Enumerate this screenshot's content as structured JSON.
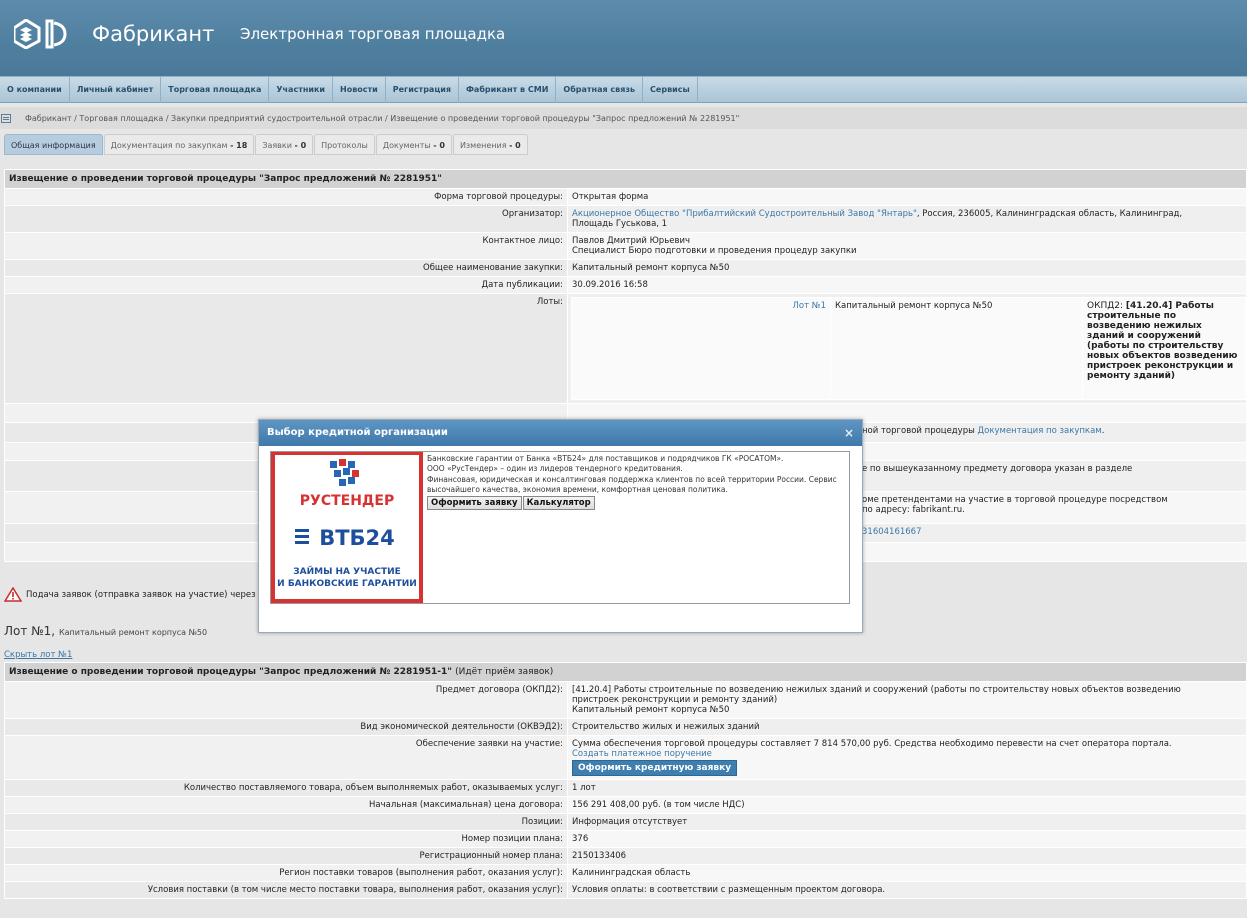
{
  "header": {
    "logo_text": "Фабрикант",
    "platform_title": "Электронная торговая площадка"
  },
  "nav": [
    "О компании",
    "Личный кабинет",
    "Торговая площадка",
    "Участники",
    "Новости",
    "Регистрация",
    "Фабрикант в СМИ",
    "Обратная связь",
    "Сервисы"
  ],
  "breadcrumb": "Фабрикант / Торговая площадка / Закупки предприятий судостроительной отрасли / Извещение о проведении торговой процедуры \"Запрос предложений № 2281951\"",
  "tabs": [
    {
      "label": "Общая информация",
      "count": ""
    },
    {
      "label": "Документация по закупкам",
      "count": "- 18"
    },
    {
      "label": "Заявки",
      "count": "- 0"
    },
    {
      "label": "Протоколы",
      "count": ""
    },
    {
      "label": "Документы",
      "count": "- 0"
    },
    {
      "label": "Изменения",
      "count": "- 0"
    }
  ],
  "notice": {
    "title": "Извещение о проведении торговой процедуры \"Запрос предложений № 2281951\"",
    "form_label": "Форма торговой процедуры:",
    "form_value": "Открытая форма",
    "org_label": "Организатор:",
    "org_link": "Акционерное Общество \"Прибалтийский Судостроительный Завод \"Янтарь\"",
    "org_rest": ", Россия, 236005, Калининградская область, Калининград,",
    "org_line2": "Площадь Гуськова, 1",
    "contact_label": "Контактное лицо:",
    "contact_name": "Павлов Дмитрий Юрьевич",
    "contact_role": "Специалист Бюро подготовки и проведения процедур закупки",
    "name_label": "Общее наименование закупки:",
    "name_value": "Капитальный ремонт корпуса №50",
    "date_label": "Дата публикации:",
    "date_value": "30.09.2016 16:58",
    "lots_label": "Лоты:",
    "lot_link": "Лот №1",
    "lot_name": "Капитальный ремонт корпуса №50",
    "lot_okpd_prefix": "ОКПД2: ",
    "lot_okpd": "[41.20.4] Работы строительные по возведению нежилых зданий и сооружений (работы по строительству новых объектов возведению пристроек реконструкции и ремонту зданий)",
    "row_docs_text": "ной торговой процедуры ",
    "row_docs_link": "Документация по закупкам",
    "row_docs_end": ".",
    "row_subject": "е по вышеуказанному предмету договора указан в разделе",
    "row_other1": "оме претендентами на участие в торговой процедуре посредством",
    "row_other2": "по адресу: fabrikant.ru.",
    "row_phone": "31604161667"
  },
  "warning_text": "Подача заявок (отправка заявок на участие) через Сі",
  "lot_section": {
    "title": "Лот №1,",
    "subtitle": "Капитальный ремонт корпуса №50",
    "hide_link": "Скрыть лот №1"
  },
  "lot_notice": {
    "title": "Извещение о проведении торговой процедуры \"Запрос предложений № 2281951-1\"",
    "status": "(Идёт приём заявок)",
    "rows": [
      {
        "label": "Предмет договора (ОКПД2):",
        "lines": [
          "[41.20.4] Работы строительные по возведению нежилых зданий и сооружений (работы по строительству новых объектов возведению",
          "пристроек реконструкции и ремонту зданий)",
          "Капитальный ремонт корпуса №50"
        ]
      },
      {
        "label": "Вид экономической деятельности (ОКВЭД2):",
        "lines": [
          "Строительство жилых и нежилых зданий"
        ]
      },
      {
        "label": "Обеспечение заявки на участие:",
        "lines": [
          "Сумма обеспечения торговой процедуры составляет 7 814 570,00 руб. Средства необходимо перевести на счет оператора портала."
        ],
        "link": "Создать платежное поручение",
        "button": "Оформить кредитную заявку"
      },
      {
        "label": "Количество поставляемого товара, объем выполняемых работ, оказываемых услуг:",
        "lines": [
          "1 лот"
        ]
      },
      {
        "label": "Начальная (максимальная) цена договора:",
        "lines": [
          "156 291 408,00 руб. (в том числе НДС)"
        ]
      },
      {
        "label": "Позиции:",
        "lines": [
          "Информация отсутствует"
        ]
      },
      {
        "label": "Номер позиции плана:",
        "lines": [
          "376"
        ]
      },
      {
        "label": "Регистрационный номер плана:",
        "lines": [
          "2150133406"
        ]
      },
      {
        "label": "Регион поставки товаров (выполнения работ, оказания услуг):",
        "lines": [
          "Калининградская область"
        ]
      },
      {
        "label": "Условия поставки (в том числе место поставки товара, выполнения работ, оказания услуг):",
        "lines": [
          "Условия оплаты: в соответствии с размещенным проектом договора."
        ]
      }
    ]
  },
  "modal": {
    "title": "Выбор кредитной организации",
    "close": "×",
    "banner_brand1": "РУСТЕНДЕР",
    "banner_brand2": "ВТБ24",
    "banner_line1": "ЗАЙМЫ НА УЧАСТИЕ",
    "banner_line2": "И БАНКОВСКИЕ ГАРАНТИИ",
    "text1": "Банковские гарантии от Банка «ВТБ24» для поставщиков и подрядчиков ГК «РОСАТОМ».",
    "text2": "ООО «РусТендер» – один из лидеров тендерного кредитования.",
    "text3": "Финансовая, юридическая и консалтинговая поддержка клиентов по всей территории России. Сервис высочайшего качества, экономия времени, комфортная ценовая политика.",
    "btn_apply": "Оформить заявку",
    "btn_calc": "Калькулятор"
  },
  "colors": {
    "header": "#4f7f9f",
    "nav": "#b8d0e0",
    "link": "#3a78a8",
    "modal_head": "#4a86b8",
    "banner_red": "#d63232",
    "vtb_blue": "#1d4f9c"
  }
}
